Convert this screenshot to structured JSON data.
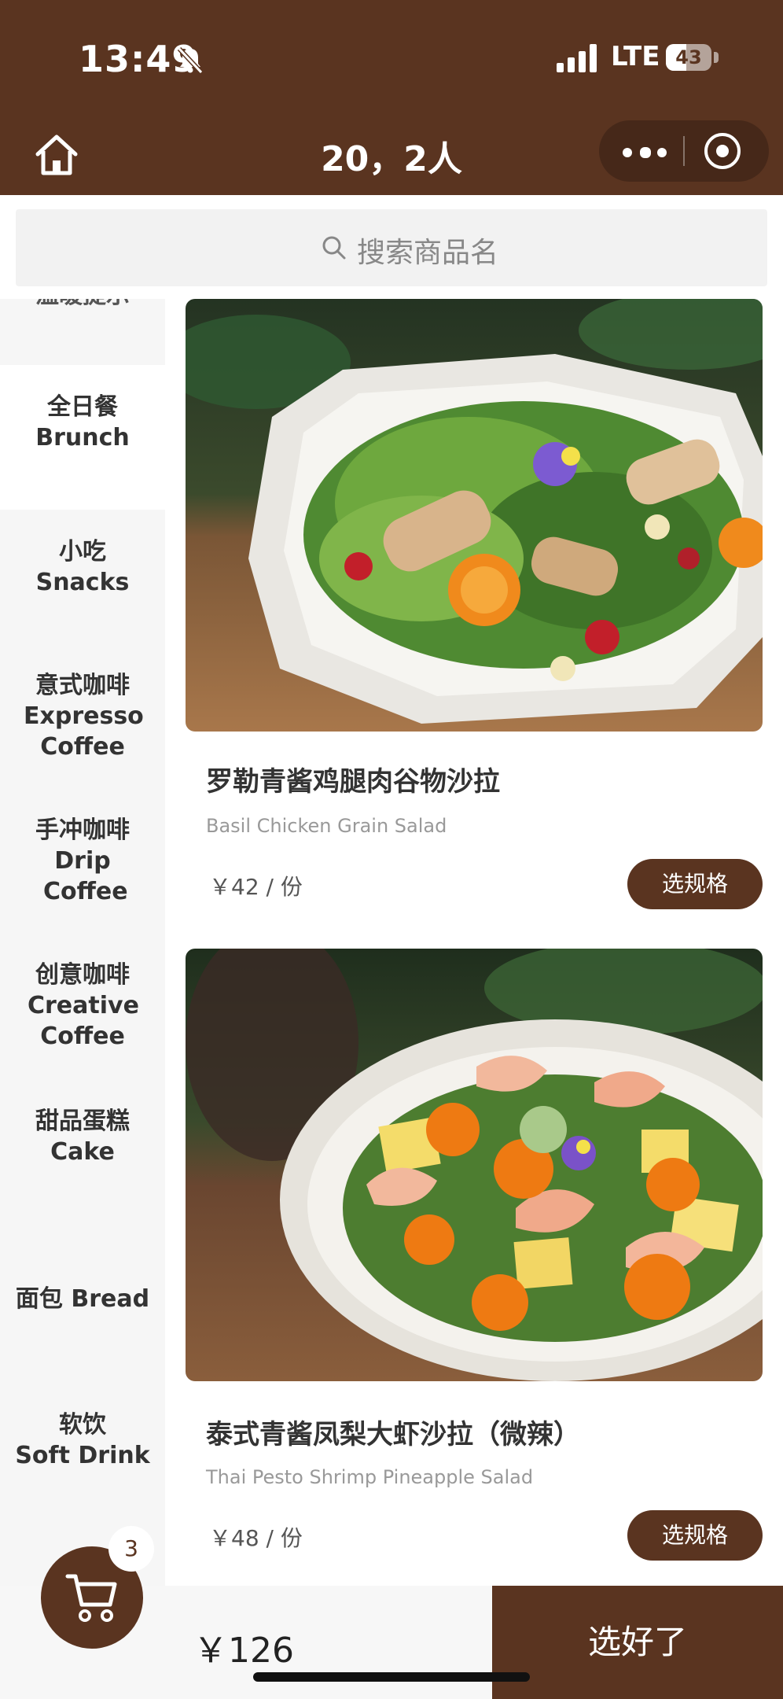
{
  "status_bar": {
    "time": "13:49",
    "network": "LTE",
    "battery": "43"
  },
  "nav": {
    "title": "20，2人"
  },
  "search": {
    "placeholder": "搜索商品名"
  },
  "sidebar": {
    "items": [
      {
        "label_cn": "温暖提示",
        "label_en": ""
      },
      {
        "label_cn": "全日餐",
        "label_en": "Brunch"
      },
      {
        "label_cn": "小吃",
        "label_en": "Snacks"
      },
      {
        "label_cn": "意式咖啡",
        "label_en": "Expresso Coffee"
      },
      {
        "label_cn": "手冲咖啡",
        "label_en": "Drip Coffee"
      },
      {
        "label_cn": "创意咖啡",
        "label_en": "Creative Coffee"
      },
      {
        "label_cn": "甜品蛋糕",
        "label_en": "Cake"
      },
      {
        "label_cn": "面包 Bread",
        "label_en": ""
      },
      {
        "label_cn": "软饮",
        "label_en": "Soft Drink"
      }
    ],
    "active_index": 1
  },
  "products": [
    {
      "name": "罗勒青酱鸡腿肉谷物沙拉",
      "name_en": "Basil Chicken Grain Salad",
      "price": "￥42 / 份",
      "button": "选规格"
    },
    {
      "name": "泰式青酱凤梨大虾沙拉（微辣）",
      "name_en": "Thai Pesto Shrimp Pineapple Salad",
      "price": "￥48 / 份",
      "button": "选规格"
    }
  ],
  "cart": {
    "count": "3",
    "total": "￥126",
    "checkout_label": "选好了"
  },
  "colors": {
    "brand": "#5a3420",
    "background": "#ffffff",
    "sidebar": "#f6f6f6"
  }
}
